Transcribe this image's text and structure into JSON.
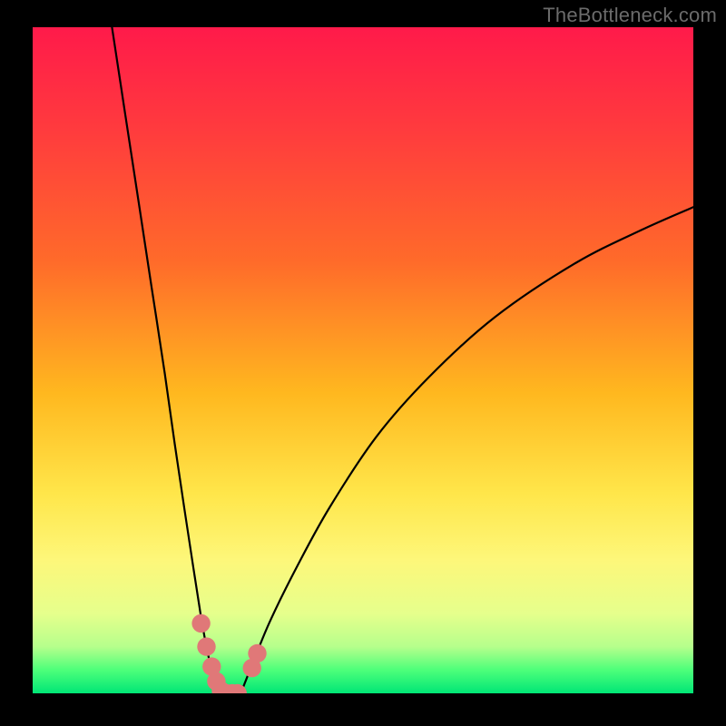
{
  "watermark": "TheBottleneck.com",
  "chart_data": {
    "type": "line",
    "title": "",
    "xlabel": "",
    "ylabel": "",
    "xlim": [
      0,
      100
    ],
    "ylim": [
      0,
      100
    ],
    "legend": null,
    "background_gradient": {
      "stops": [
        {
          "pos": 0.0,
          "color": "#ff1a4a"
        },
        {
          "pos": 0.15,
          "color": "#ff3a3e"
        },
        {
          "pos": 0.35,
          "color": "#ff6a2a"
        },
        {
          "pos": 0.55,
          "color": "#ffb81f"
        },
        {
          "pos": 0.7,
          "color": "#ffe64a"
        },
        {
          "pos": 0.8,
          "color": "#fdf77a"
        },
        {
          "pos": 0.88,
          "color": "#e6ff8c"
        },
        {
          "pos": 0.93,
          "color": "#b6ff8c"
        },
        {
          "pos": 0.965,
          "color": "#4dff7a"
        },
        {
          "pos": 1.0,
          "color": "#00e676"
        }
      ]
    },
    "series": [
      {
        "name": "curve-left",
        "x": [
          12.0,
          14.0,
          16.0,
          18.0,
          20.0,
          21.5,
          23.0,
          24.3,
          25.4,
          26.3,
          27.1,
          27.8,
          28.4
        ],
        "y": [
          100.0,
          87.0,
          74.0,
          61.0,
          48.0,
          37.5,
          27.5,
          19.0,
          12.0,
          7.0,
          3.5,
          1.2,
          0.0
        ],
        "color": "#000000"
      },
      {
        "name": "curve-flat",
        "x": [
          28.4,
          31.5
        ],
        "y": [
          0.0,
          0.0
        ],
        "color": "#000000"
      },
      {
        "name": "curve-right",
        "x": [
          31.5,
          33.5,
          36.0,
          40.0,
          45.0,
          52.0,
          60.0,
          70.0,
          82.0,
          92.0,
          100.0
        ],
        "y": [
          0.0,
          5.0,
          11.0,
          19.0,
          28.0,
          38.5,
          47.5,
          56.5,
          64.5,
          69.5,
          73.0
        ],
        "color": "#000000"
      }
    ],
    "markers": {
      "color": "#e07878",
      "radius": 1.4,
      "points": [
        {
          "x": 25.5,
          "y": 10.5
        },
        {
          "x": 26.3,
          "y": 7.0
        },
        {
          "x": 27.1,
          "y": 4.0
        },
        {
          "x": 27.8,
          "y": 1.8
        },
        {
          "x": 28.5,
          "y": 0.4
        },
        {
          "x": 29.3,
          "y": 0.0
        },
        {
          "x": 30.2,
          "y": 0.0
        },
        {
          "x": 31.0,
          "y": 0.0
        },
        {
          "x": 33.2,
          "y": 3.8
        },
        {
          "x": 34.0,
          "y": 6.0
        }
      ]
    }
  }
}
